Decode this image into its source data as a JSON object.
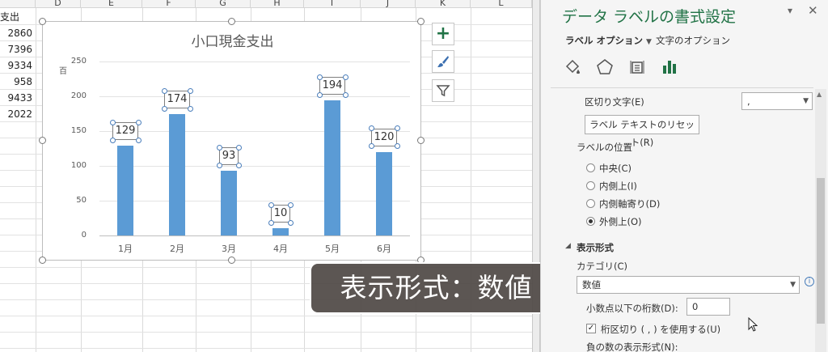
{
  "sheet": {
    "columns": [
      "D",
      "E",
      "F",
      "G",
      "H",
      "I",
      "J",
      "K",
      "L"
    ],
    "header_cell": "支出",
    "values": [
      "2860",
      "7396",
      "9334",
      "958",
      "9433",
      "2022"
    ]
  },
  "chart_buttons": [
    {
      "icon": "plus-icon",
      "label": "グラフ要素"
    },
    {
      "icon": "brush-icon",
      "label": "グラフ スタイル"
    },
    {
      "icon": "filter-icon",
      "label": "グラフ フィルター"
    }
  ],
  "chart_data": {
    "type": "bar",
    "title": "小口現金支出",
    "ylabel": "百",
    "categories": [
      "1月",
      "2月",
      "3月",
      "4月",
      "5月",
      "6月"
    ],
    "values": [
      129,
      174,
      93,
      10,
      194,
      120
    ],
    "data_labels": [
      "129",
      "174",
      "93",
      "10",
      "194",
      "120"
    ],
    "yticks": [
      "250",
      "200",
      "150",
      "100",
      "50",
      "0"
    ],
    "ylim": [
      0,
      250
    ],
    "grid": true,
    "bar_color": "#5b9bd5"
  },
  "caption": "表示形式：数値",
  "pane": {
    "title": "データ ラベルの書式設定",
    "tabs": [
      "ラベル オプション",
      "文字のオプション"
    ],
    "icons": [
      "fill-line-icon",
      "effects-pentagon-icon",
      "size-properties-icon",
      "label-options-bar-icon"
    ],
    "separator": {
      "label": "区切り文字(E)",
      "value": ","
    },
    "reset_button": "ラベル テキストのリセット(R)",
    "position": {
      "heading": "ラベルの位置",
      "options": [
        "中央(C)",
        "内側上(I)",
        "内側軸寄り(D)",
        "外側上(O)"
      ],
      "selected": "外側上(O)"
    },
    "number": {
      "heading": "表示形式",
      "category_label": "カテゴリ(C)",
      "category_value": "数値",
      "decimal_label": "小数点以下の桁数(D):",
      "decimal_value": "0",
      "thousands_label": "桁区切り ( , ) を使用する(U)",
      "thousands_checked": true,
      "negative_label": "負の数の表示形式(N):"
    }
  },
  "colors": {
    "accent": "#217346",
    "bar": "#5b9bd5",
    "handle": "#4a7ebb"
  }
}
